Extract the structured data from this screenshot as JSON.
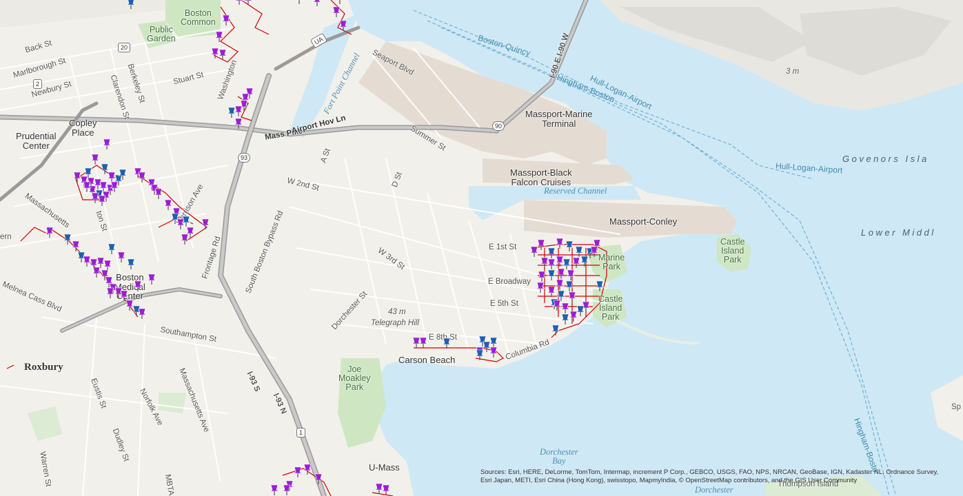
{
  "map": {
    "colors": {
      "water": "#cfe8f5",
      "land": "#f2f0ea",
      "park": "#cfe6c3",
      "industrial": "#e4dcd2",
      "airport": "#e9e7e2",
      "road": "#ffffff",
      "highway": "#9a9a9a",
      "route_line": "#cc0000",
      "pin_purple": "#9b1ed6",
      "pin_blue": "#1f5fb0"
    },
    "marker_types": [
      "pin-purple-icon",
      "pin-blue-icon"
    ],
    "neighborhoods": {
      "roxbury": "Roxbury",
      "prudential": "Prudential\nCenter",
      "copley": "Copley\nPlace",
      "medical": "Boston\nMedical\nCenter"
    },
    "parks": {
      "common": "Boston\nCommon",
      "garden": "Public\nGarden",
      "moakley": "Joe\nMoakley\nPark",
      "marine": "Marine\nPark",
      "castle_park": "Castle\nIsland\nPark",
      "castle_island": "Castle\nIsland\nPark"
    },
    "water": {
      "fort_point": "Fort Point Channel",
      "reserved": "Reserved Channel",
      "dorchester_bay": "Dorchester\nBay",
      "dorchester_bottom": "Dorchester",
      "govenors": "Govenors Isla",
      "lower_middle": "Lower Middl"
    },
    "ferry_routes": {
      "boston_quincy": "Boston-Quincy",
      "hingham_boston": "Hingham-Boston",
      "hull_logan_1": "Hull-Logan-Airport",
      "hull_logan_2": "Hull-Logan-Airport",
      "hingham_boston_2": "Hingham-Bosto"
    },
    "places": {
      "massport_marine": "Massport-Marine\nTerminal",
      "massport_black": "Massport-Black\nFalcon Cruises",
      "massport_conley": "Massport-Conley",
      "carson_beach": "Carson Beach",
      "telegraph_hill": "Telegraph Hill",
      "umass": "U-Mass",
      "thompson": "Thompson Island",
      "sp": "Sp"
    },
    "elevations": {
      "e1": "3 m",
      "e2": "43 m"
    },
    "roads": {
      "back_st": "Back St",
      "marlborough": "Marlborough St",
      "newbury": "Newbury St",
      "stuart": "Stuart St",
      "clarendon": "Clarendon St",
      "berkeley": "Berkeley St",
      "washington": "Washington",
      "seaport": "Seaport Blvd",
      "mass_pike": "Mass Pike",
      "airport_hov": "Airport Hov Ln",
      "summer": "Summer St",
      "a_st": "A St",
      "d_st": "D St",
      "w2nd": "W 2nd St",
      "w3rd": "W 3rd St",
      "sb_bypass": "South Boston Bypass Rd",
      "frontage": "Frontage Rd",
      "dorchester_st": "Dorchester St",
      "e1st": "E 1st St",
      "ebroadway": "E Broadway",
      "e5th": "E 5th St",
      "e8th": "E 8th St",
      "columbia": "Columbia Rd",
      "harrison": "Harrison Ave",
      "massachusetts": "Massachusetts",
      "southampton": "Southampton St",
      "melnea": "Melnea Cass Blvd",
      "massachusetts_ave": "Massachusetts Ave",
      "norfolk": "Norfolk Ave",
      "dudley": "Dudley St",
      "eustis": "Eustis St",
      "warren": "Warren St",
      "i93s": "I-93 S",
      "i93n": "I-93 N",
      "i90": "I-90 E I-90 W",
      "tton": "ton St",
      "ern": "ern",
      "mbta": "MBTA"
    },
    "shields": {
      "s20": "20",
      "s2": "2",
      "s93": "93",
      "s90": "90",
      "s1": "1",
      "sua": "UA"
    },
    "attribution": "Sources: Esri, HERE, DeLorme, TomTom, Intermap, increment P Corp., GEBCO, USGS, FAO, NPS, NRCAN, GeoBase, IGN, Kadaster NL, Ordnance Survey, Esri Japan, METI, Esri China (Hong Kong), swisstopo, MapmyIndia, © OpenStreetMap contributors, and the GIS User Community"
  }
}
